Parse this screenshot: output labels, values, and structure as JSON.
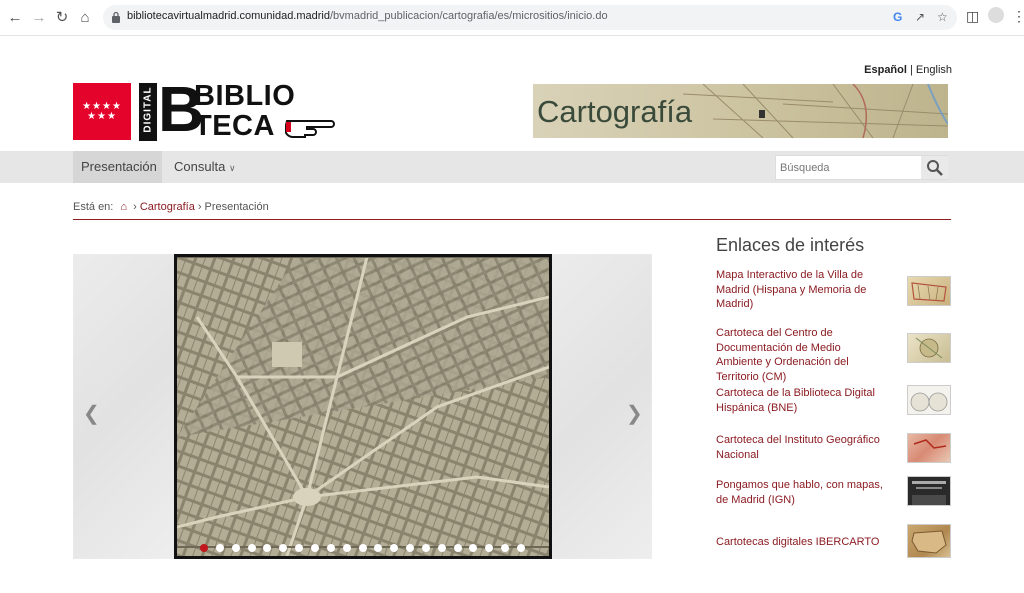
{
  "browser": {
    "url_domain": "bibliotecavirtualmadrid.comunidad.madrid",
    "url_path": "/bvmadrid_publicacion/cartografia/es/micrositios/inicio.do"
  },
  "languages": {
    "selected": "Español",
    "separator": "|",
    "other": "English"
  },
  "logo": {
    "digital": "DIGITAL",
    "big_letter": "B",
    "line1": "BIBLIO",
    "line2": "TECA"
  },
  "banner": {
    "title": "Cartografía"
  },
  "nav": {
    "items": [
      {
        "label": "Presentación"
      },
      {
        "label": "Consulta"
      }
    ],
    "search_placeholder": "Búsqueda"
  },
  "breadcrumb": {
    "prefix": "Está en:",
    "items": [
      "Cartografía",
      "Presentación"
    ]
  },
  "carousel": {
    "dot_count": 21,
    "active_index": 0
  },
  "links": {
    "title": "Enlaces de interés",
    "items": [
      {
        "label": "Mapa Interactivo de la Villa de Madrid (Hispana y Memoria de Madrid)"
      },
      {
        "label": "Cartoteca del Centro de Documentación de Medio Ambiente y Ordenación del Territorio (CM)"
      },
      {
        "label": "Cartoteca de la Biblioteca Digital Hispánica (BNE)"
      },
      {
        "label": "Cartoteca del Instituto Geográfico Nacional"
      },
      {
        "label": "Pongamos que hablo, con mapas, de Madrid (IGN)"
      },
      {
        "label": "Cartotecas digitales IBERCARTO"
      }
    ]
  },
  "colors": {
    "accent": "#8b1c22",
    "madrid_red": "#e4032b",
    "nav_bg": "#e6e6e6"
  }
}
